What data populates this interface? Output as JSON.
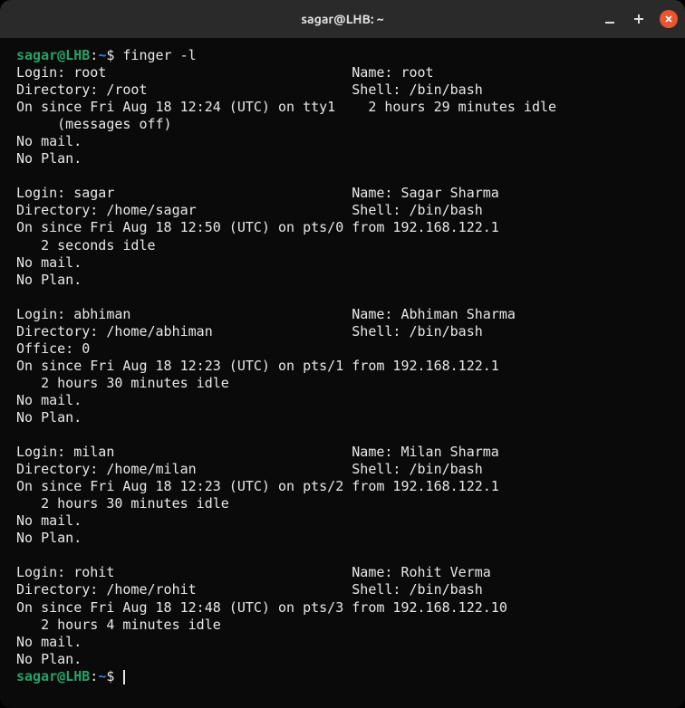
{
  "window": {
    "title": "sagar@LHB: ~"
  },
  "prompt": {
    "user_host": "sagar@LHB",
    "path": "~",
    "dollar": "$"
  },
  "command": "finger -l",
  "users": [
    {
      "login_line": "Login: root                              Name: root",
      "dir_line": "Directory: /root                         Shell: /bin/bash",
      "on_line": "On since Fri Aug 18 12:24 (UTC) on tty1    2 hours 29 minutes idle",
      "extra_line": "     (messages off)",
      "mail_line": "No mail.",
      "plan_line": "No Plan."
    },
    {
      "login_line": "Login: sagar                             Name: Sagar Sharma",
      "dir_line": "Directory: /home/sagar                   Shell: /bin/bash",
      "on_line": "On since Fri Aug 18 12:50 (UTC) on pts/0 from 192.168.122.1",
      "extra_line": "   2 seconds idle",
      "mail_line": "No mail.",
      "plan_line": "No Plan."
    },
    {
      "login_line": "Login: abhiman                           Name: Abhiman Sharma",
      "dir_line": "Directory: /home/abhiman                 Shell: /bin/bash",
      "office_line": "Office: 0",
      "on_line": "On since Fri Aug 18 12:23 (UTC) on pts/1 from 192.168.122.1",
      "extra_line": "   2 hours 30 minutes idle",
      "mail_line": "No mail.",
      "plan_line": "No Plan."
    },
    {
      "login_line": "Login: milan                             Name: Milan Sharma",
      "dir_line": "Directory: /home/milan                   Shell: /bin/bash",
      "on_line": "On since Fri Aug 18 12:23 (UTC) on pts/2 from 192.168.122.1",
      "extra_line": "   2 hours 30 minutes idle",
      "mail_line": "No mail.",
      "plan_line": "No Plan."
    },
    {
      "login_line": "Login: rohit                             Name: Rohit Verma",
      "dir_line": "Directory: /home/rohit                   Shell: /bin/bash",
      "on_line": "On since Fri Aug 18 12:48 (UTC) on pts/3 from 192.168.122.10",
      "extra_line": "   2 hours 4 minutes idle",
      "mail_line": "No mail.",
      "plan_line": "No Plan."
    }
  ]
}
